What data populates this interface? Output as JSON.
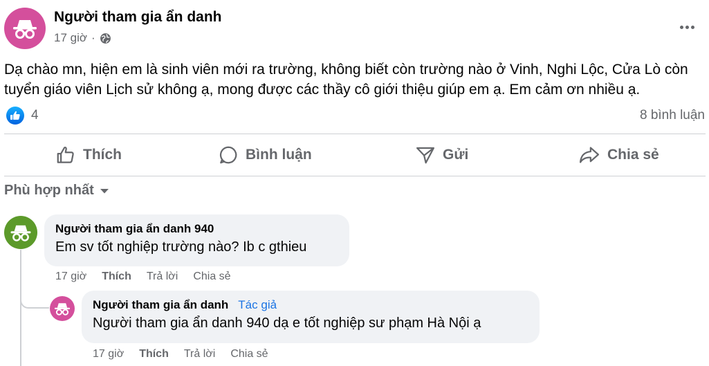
{
  "post": {
    "author": "Người tham gia ẩn danh",
    "time": "17 giờ",
    "separator": "·",
    "body": "Dạ chào mn, hiện em là sinh viên mới ra trường, không biết còn trường nào ở Vinh, Nghi Lộc, Cửa Lò còn tuyển giáo viên Lịch sử không ạ, mong được các thầy cô giới thiệu giúp em ạ. Em cảm ơn nhiều ạ.",
    "reaction_count": "4",
    "comment_count": "8 bình luận",
    "avatar_color": "#d44f9c"
  },
  "actions": {
    "like": "Thích",
    "comment": "Bình luận",
    "send": "Gửi",
    "share": "Chia sẻ"
  },
  "sort": {
    "label": "Phù hợp nhất"
  },
  "comments": [
    {
      "author": "Người tham gia ẩn danh 940",
      "text": "Em sv tốt nghiệp trường nào? Ib c gthieu",
      "time": "17 giờ",
      "like": "Thích",
      "reply": "Trả lời",
      "share": "Chia sẻ",
      "avatar_color": "#5c9a2a"
    },
    {
      "author": "Người tham gia ẩn danh",
      "badge": "Tác giả",
      "text": "Người tham gia ẩn danh 940 dạ e tốt nghiệp sư phạm Hà Nội ạ",
      "time": "17 giờ",
      "like": "Thích",
      "reply": "Trả lời",
      "share": "Chia sẻ",
      "avatar_color": "#d44f9c"
    }
  ],
  "icons": {
    "privacy": "globe-icon",
    "reaction": "like-reaction-icon",
    "like": "thumbs-up-icon",
    "comment": "comment-icon",
    "send": "send-icon",
    "share": "share-icon",
    "sort": "caret-down-icon",
    "more": "more-options-icon",
    "avatar": "anonymous-incognito-icon"
  },
  "colors": {
    "link_blue": "#1b74e4",
    "meta_gray": "#65676b",
    "bubble_bg": "#f0f2f5"
  }
}
